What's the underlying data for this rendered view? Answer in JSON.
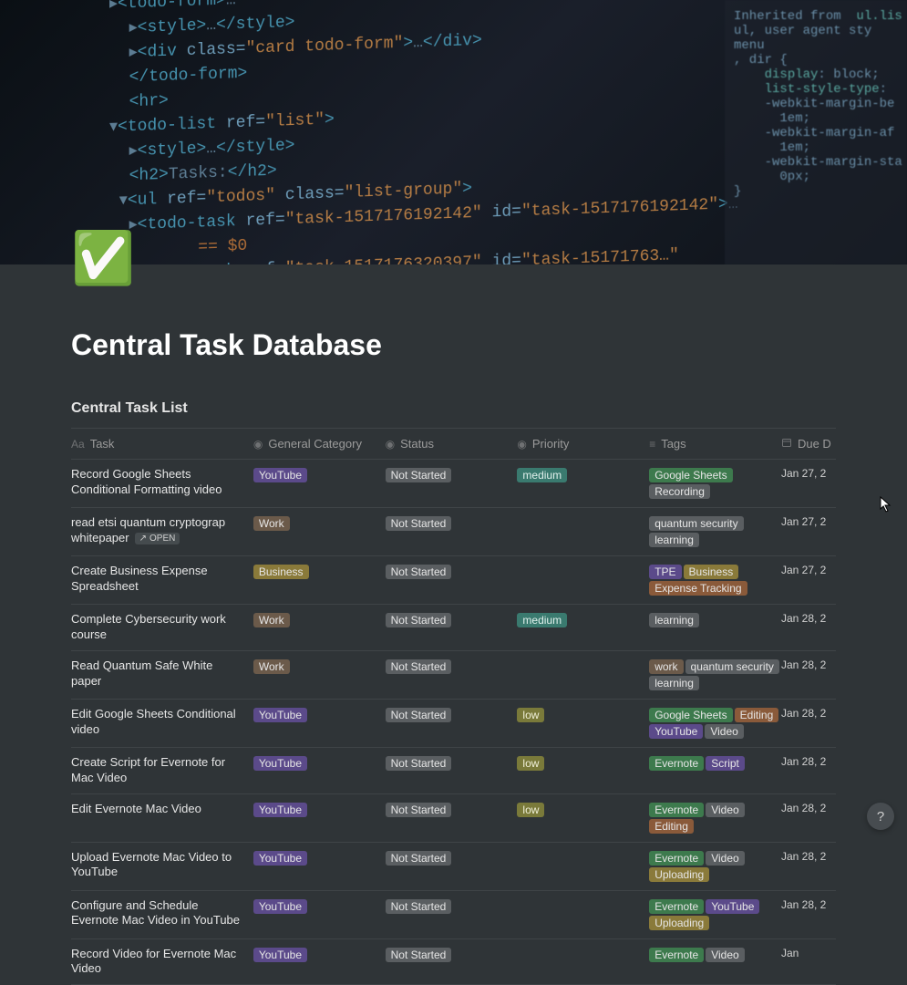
{
  "page": {
    "icon": "✅",
    "title": "Central Task Database",
    "view_title": "Central Task List"
  },
  "columns": {
    "task": {
      "label": "Task",
      "icon_name": "text-icon",
      "icon": "Aa"
    },
    "category": {
      "label": "General Category",
      "icon_name": "select-icon",
      "icon": "◉"
    },
    "status": {
      "label": "Status",
      "icon_name": "select-icon",
      "icon": "◉"
    },
    "priority": {
      "label": "Priority",
      "icon_name": "select-icon",
      "icon": "◉"
    },
    "tags": {
      "label": "Tags",
      "icon_name": "multiselect-icon",
      "icon": "≡"
    },
    "due": {
      "label": "Due D",
      "icon_name": "date-icon",
      "icon": "📅"
    }
  },
  "open_button": {
    "label": "OPEN",
    "icon": "↗"
  },
  "tag_colors": {
    "YouTube": "purple",
    "Work": "brown",
    "Business": "yellow",
    "Not Started": "gray",
    "medium": "teal",
    "low": "olive",
    "Google Sheets": "green",
    "Recording": "gray",
    "quantum security": "gray",
    "learning": "gray",
    "TPE": "purple",
    "Expense Tracking": "orange",
    "work": "brown",
    "Editing": "orange",
    "Video": "gray",
    "Evernote": "green",
    "Script": "purple",
    "Uploading": "yellow"
  },
  "rows": [
    {
      "task": "Record Google Sheets Conditional Formatting video",
      "category": "YouTube",
      "status": "Not Started",
      "priority": "medium",
      "tags": [
        "Google Sheets",
        "Recording"
      ],
      "due": "Jan 27, 2",
      "hovered": false
    },
    {
      "task": "read etsi quantum cryptograp whitepaper",
      "category": "Work",
      "status": "Not Started",
      "priority": "",
      "tags": [
        "quantum security",
        "learning"
      ],
      "due": "Jan 27, 2",
      "hovered": true
    },
    {
      "task": "Create Business Expense Spreadsheet",
      "category": "Business",
      "status": "Not Started",
      "priority": "",
      "tags": [
        "TPE",
        "Business",
        "Expense Tracking"
      ],
      "due": "Jan 27, 2",
      "hovered": false
    },
    {
      "task": "Complete Cybersecurity work course",
      "category": "Work",
      "status": "Not Started",
      "priority": "medium",
      "tags": [
        "learning"
      ],
      "due": "Jan 28, 2",
      "hovered": false
    },
    {
      "task": "Read Quantum Safe White paper",
      "category": "Work",
      "status": "Not Started",
      "priority": "",
      "tags": [
        "work",
        "quantum security",
        "learning"
      ],
      "due": "Jan 28, 2",
      "hovered": false
    },
    {
      "task": "Edit Google Sheets Conditional video",
      "category": "YouTube",
      "status": "Not Started",
      "priority": "low",
      "tags": [
        "Google Sheets",
        "Editing",
        "YouTube",
        "Video"
      ],
      "due": "Jan 28, 2",
      "hovered": false
    },
    {
      "task": "Create Script for Evernote for Mac Video",
      "category": "YouTube",
      "status": "Not Started",
      "priority": "low",
      "tags": [
        "Evernote",
        "Script"
      ],
      "due": "Jan 28, 2",
      "hovered": false
    },
    {
      "task": "Edit Evernote Mac Video",
      "category": "YouTube",
      "status": "Not Started",
      "priority": "low",
      "tags": [
        "Evernote",
        "Video",
        "Editing"
      ],
      "due": "Jan 28, 2",
      "hovered": false
    },
    {
      "task": "Upload Evernote Mac Video to YouTube",
      "category": "YouTube",
      "status": "Not Started",
      "priority": "",
      "tags": [
        "Evernote",
        "Video",
        "Uploading"
      ],
      "due": "Jan 28, 2",
      "hovered": false
    },
    {
      "task": "Configure and Schedule Evernote Mac Video in YouTube",
      "category": "YouTube",
      "status": "Not Started",
      "priority": "",
      "tags": [
        "Evernote",
        "YouTube",
        "Uploading"
      ],
      "due": "Jan 28, 2",
      "hovered": false
    },
    {
      "task": "Record Video for Evernote Mac Video",
      "category": "YouTube",
      "status": "Not Started",
      "priority": "",
      "tags": [
        "Evernote",
        "Video"
      ],
      "due": "Jan",
      "hovered": false
    }
  ],
  "help": {
    "label": "?"
  }
}
